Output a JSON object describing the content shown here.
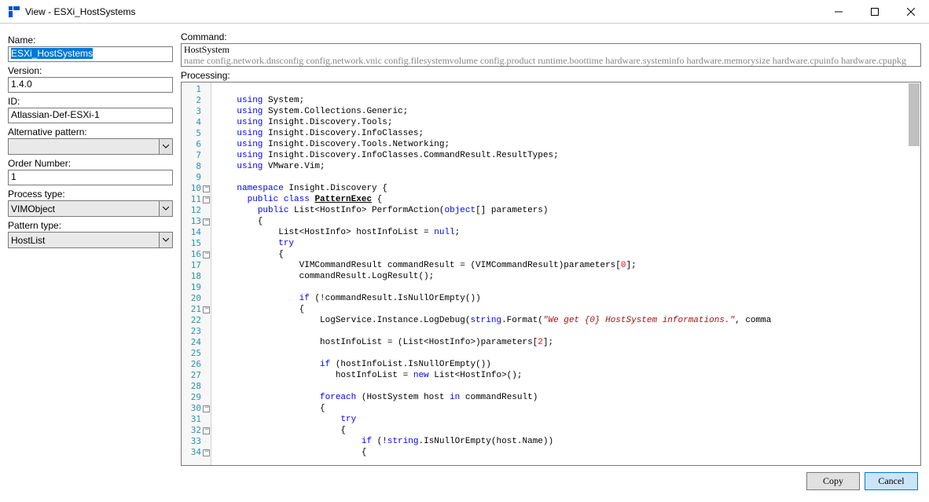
{
  "window": {
    "title": "View - ESXi_HostSystems"
  },
  "form": {
    "name_label": "Name:",
    "name_value": "ESXi_HostSystems",
    "version_label": "Version:",
    "version_value": "1.4.0",
    "id_label": "ID:",
    "id_value": "Atlassian-Def-ESXi-1",
    "altpat_label": "Alternative pattern:",
    "altpat_value": "",
    "order_label": "Order Number:",
    "order_value": "1",
    "proctype_label": "Process type:",
    "proctype_value": "VIMObject",
    "pattype_label": "Pattern type:",
    "pattype_value": "HostList"
  },
  "command": {
    "label": "Command:",
    "line1": "HostSystem",
    "line2": "name config.network.dnsconfig config.network.vnic config.filesystemvolume config.product runtime.boottime hardware.systeminfo hardware.memorysize hardware.cpuinfo hardware.cpupkg"
  },
  "processing": {
    "label": "Processing:"
  },
  "code_lines": [
    {
      "n": 1,
      "fold": false,
      "html": ""
    },
    {
      "n": 2,
      "fold": false,
      "html": "    <span class='kw'>using</span> System;"
    },
    {
      "n": 3,
      "fold": false,
      "html": "    <span class='kw'>using</span> System.Collections.Generic;"
    },
    {
      "n": 4,
      "fold": false,
      "html": "    <span class='kw'>using</span> Insight.Discovery.Tools;"
    },
    {
      "n": 5,
      "fold": false,
      "html": "    <span class='kw'>using</span> Insight.Discovery.InfoClasses;"
    },
    {
      "n": 6,
      "fold": false,
      "html": "    <span class='kw'>using</span> Insight.Discovery.Tools.Networking;"
    },
    {
      "n": 7,
      "fold": false,
      "html": "    <span class='kw'>using</span> Insight.Discovery.InfoClasses.CommandResult.ResultTypes;"
    },
    {
      "n": 8,
      "fold": false,
      "html": "    <span class='kw'>using</span> VMware.Vim;"
    },
    {
      "n": 9,
      "fold": false,
      "html": ""
    },
    {
      "n": 10,
      "fold": true,
      "html": "    <span class='kw'>namespace</span> Insight.Discovery {"
    },
    {
      "n": 11,
      "fold": true,
      "html": "      <span class='kw'>public</span> <span class='kw'>class</span> <span class='cls'>PatternExec</span> {"
    },
    {
      "n": 12,
      "fold": false,
      "html": "        <span class='kw'>public</span> List&lt;HostInfo&gt; PerformAction(<span class='kw'>object</span>[] parameters)"
    },
    {
      "n": 13,
      "fold": true,
      "html": "        {"
    },
    {
      "n": 14,
      "fold": false,
      "html": "            List&lt;HostInfo&gt; hostInfoList = <span class='kw'>null</span>;"
    },
    {
      "n": 15,
      "fold": false,
      "html": "            <span class='kw'>try</span>"
    },
    {
      "n": 16,
      "fold": true,
      "html": "            {"
    },
    {
      "n": 17,
      "fold": false,
      "html": "                VIMCommandResult commandResult = (VIMCommandResult)parameters[<span class='num'>0</span>];"
    },
    {
      "n": 18,
      "fold": false,
      "html": "                commandResult.LogResult();"
    },
    {
      "n": 19,
      "fold": false,
      "html": ""
    },
    {
      "n": 20,
      "fold": false,
      "html": "                <span class='kw'>if</span> (!commandResult.IsNullOrEmpty())"
    },
    {
      "n": 21,
      "fold": true,
      "html": "                {"
    },
    {
      "n": 22,
      "fold": false,
      "html": "                    LogService.Instance.LogDebug(<span class='kw'>string</span>.Format(<span class='str'>\"We get {0} HostSystem informations.\"</span>, comma"
    },
    {
      "n": 23,
      "fold": false,
      "html": ""
    },
    {
      "n": 24,
      "fold": false,
      "html": "                    hostInfoList = (List&lt;HostInfo&gt;)parameters[<span class='num'>2</span>];"
    },
    {
      "n": 25,
      "fold": false,
      "html": ""
    },
    {
      "n": 26,
      "fold": false,
      "html": "                    <span class='kw'>if</span> (hostInfoList.IsNullOrEmpty())"
    },
    {
      "n": 27,
      "fold": false,
      "html": "                       hostInfoList = <span class='kw'>new</span> List&lt;HostInfo&gt;();"
    },
    {
      "n": 28,
      "fold": false,
      "html": ""
    },
    {
      "n": 29,
      "fold": false,
      "html": "                    <span class='kw'>foreach</span> (HostSystem host <span class='kw'>in</span> commandResult)"
    },
    {
      "n": 30,
      "fold": true,
      "html": "                    {"
    },
    {
      "n": 31,
      "fold": false,
      "html": "                        <span class='kw'>try</span>"
    },
    {
      "n": 32,
      "fold": true,
      "html": "                        {"
    },
    {
      "n": 33,
      "fold": false,
      "html": "                            <span class='kw'>if</span> (!<span class='kw'>string</span>.IsNullOrEmpty(host.Name))"
    },
    {
      "n": 34,
      "fold": true,
      "html": "                            {"
    }
  ],
  "buttons": {
    "copy": "Copy",
    "cancel": "Cancel"
  }
}
